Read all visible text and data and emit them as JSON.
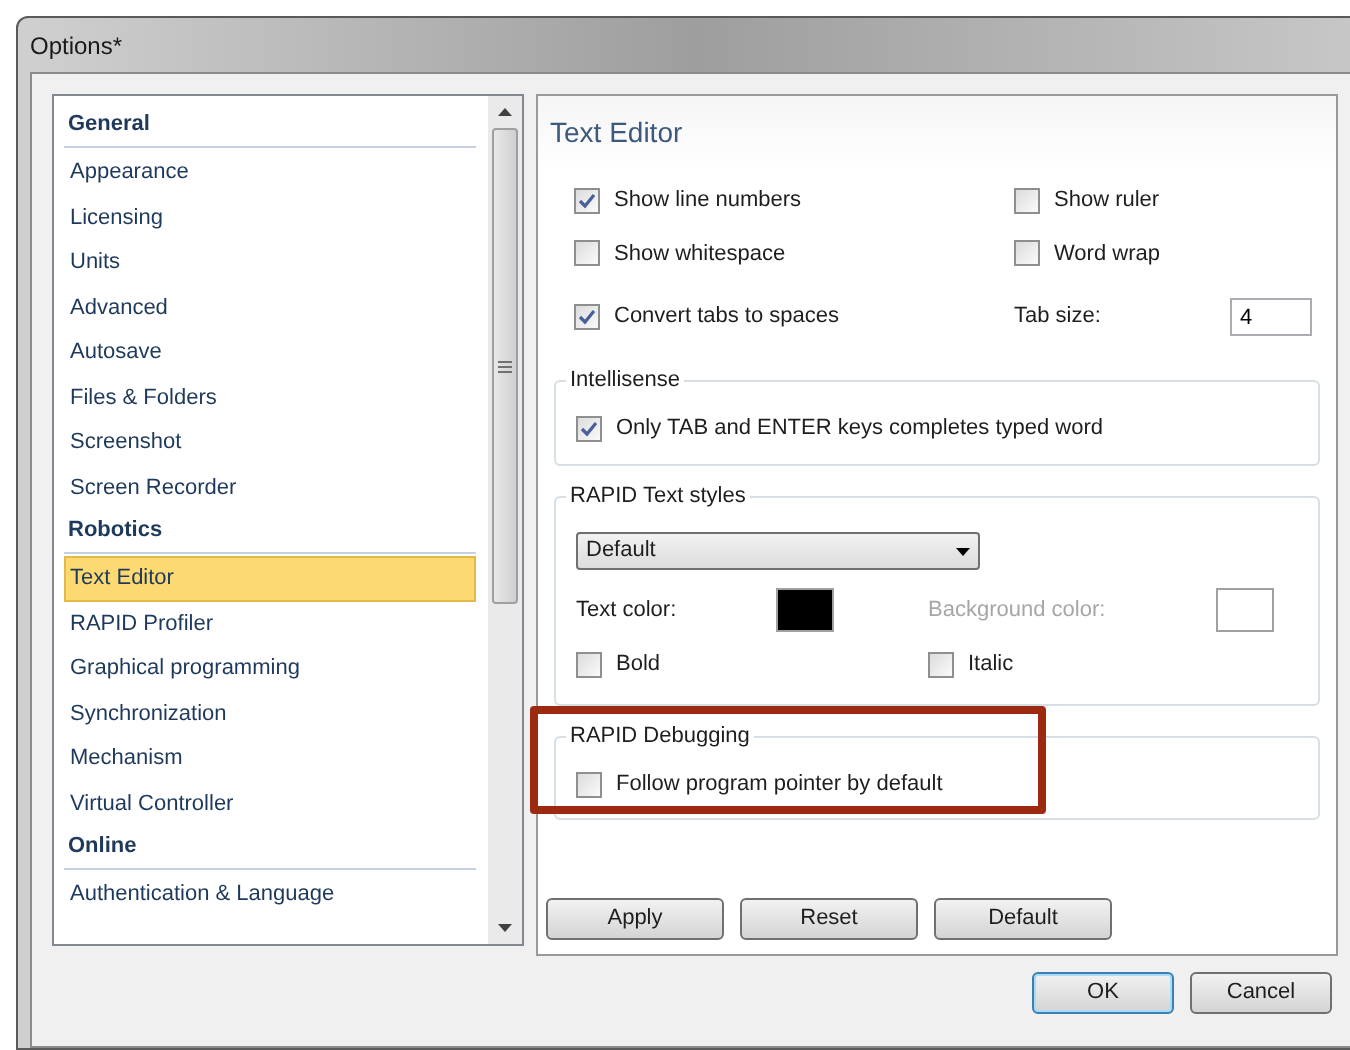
{
  "window": {
    "title": "Options*"
  },
  "sidebar": {
    "groups": [
      {
        "heading": "General",
        "items": [
          {
            "label": "Appearance",
            "selected": false
          },
          {
            "label": "Licensing",
            "selected": false
          },
          {
            "label": "Units",
            "selected": false
          },
          {
            "label": "Advanced",
            "selected": false
          },
          {
            "label": "Autosave",
            "selected": false
          },
          {
            "label": "Files & Folders",
            "selected": false
          },
          {
            "label": "Screenshot",
            "selected": false
          },
          {
            "label": "Screen Recorder",
            "selected": false
          }
        ]
      },
      {
        "heading": "Robotics",
        "items": [
          {
            "label": "Text Editor",
            "selected": true
          },
          {
            "label": "RAPID Profiler",
            "selected": false
          },
          {
            "label": "Graphical programming",
            "selected": false
          },
          {
            "label": "Synchronization",
            "selected": false
          },
          {
            "label": "Mechanism",
            "selected": false
          },
          {
            "label": "Virtual Controller",
            "selected": false
          }
        ]
      },
      {
        "heading": "Online",
        "items": [
          {
            "label": "Authentication & Language",
            "selected": false
          }
        ]
      }
    ]
  },
  "panel": {
    "title": "Text Editor",
    "options": [
      {
        "label": "Show line numbers",
        "checked": true
      },
      {
        "label": "Show ruler",
        "checked": false
      },
      {
        "label": "Show whitespace",
        "checked": false
      },
      {
        "label": "Word wrap",
        "checked": false
      }
    ],
    "convert_tabs": {
      "label": "Convert tabs to spaces",
      "checked": true
    },
    "tab_size": {
      "label": "Tab size:",
      "value": "4"
    },
    "intellisense": {
      "title": "Intellisense",
      "option": {
        "label": "Only TAB and ENTER keys completes typed word",
        "checked": true
      }
    },
    "text_styles": {
      "title": "RAPID Text styles",
      "style": "Default",
      "text_color": {
        "label": "Text color:",
        "color": "#000000",
        "disabled": false
      },
      "background_color": {
        "label": "Background color:",
        "color": "#ffffff",
        "disabled": true
      },
      "bold": {
        "label": "Bold",
        "checked": false
      },
      "italic": {
        "label": "Italic",
        "checked": false
      }
    },
    "debugging": {
      "title": "RAPID Debugging",
      "option": {
        "label": "Follow program pointer by default",
        "checked": false
      }
    },
    "buttons": [
      "Apply",
      "Reset",
      "Default"
    ]
  },
  "footer_buttons": [
    {
      "label": "OK",
      "default": true
    },
    {
      "label": "Cancel",
      "default": false
    }
  ]
}
